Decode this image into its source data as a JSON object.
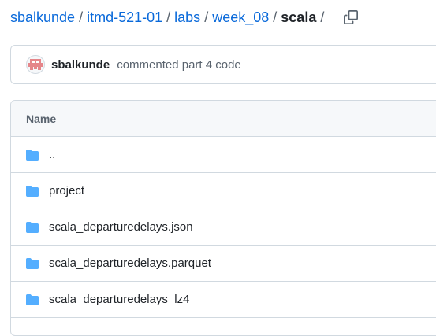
{
  "breadcrumb": {
    "owner": "sbalkunde",
    "repo": "itmd-521-01",
    "folder1": "labs",
    "folder2": "week_08",
    "current": "scala",
    "separator": "/"
  },
  "icons": {
    "copy": "copy-icon",
    "avatar": "identicon",
    "folder": "folder-icon"
  },
  "commit": {
    "author": "sbalkunde",
    "message": "commented part 4 code"
  },
  "table": {
    "column_name": "Name",
    "rows": [
      {
        "name": ".."
      },
      {
        "name": "project"
      },
      {
        "name": "scala_departuredelays.json"
      },
      {
        "name": "scala_departuredelays.parquet"
      },
      {
        "name": "scala_departuredelays_lz4"
      }
    ]
  },
  "colors": {
    "link": "#0969da",
    "folder": "#54aeff",
    "border": "#d1d9e0",
    "header_bg": "#f6f8fa",
    "muted": "#59636e",
    "avatar_accent": "#e5868a"
  }
}
